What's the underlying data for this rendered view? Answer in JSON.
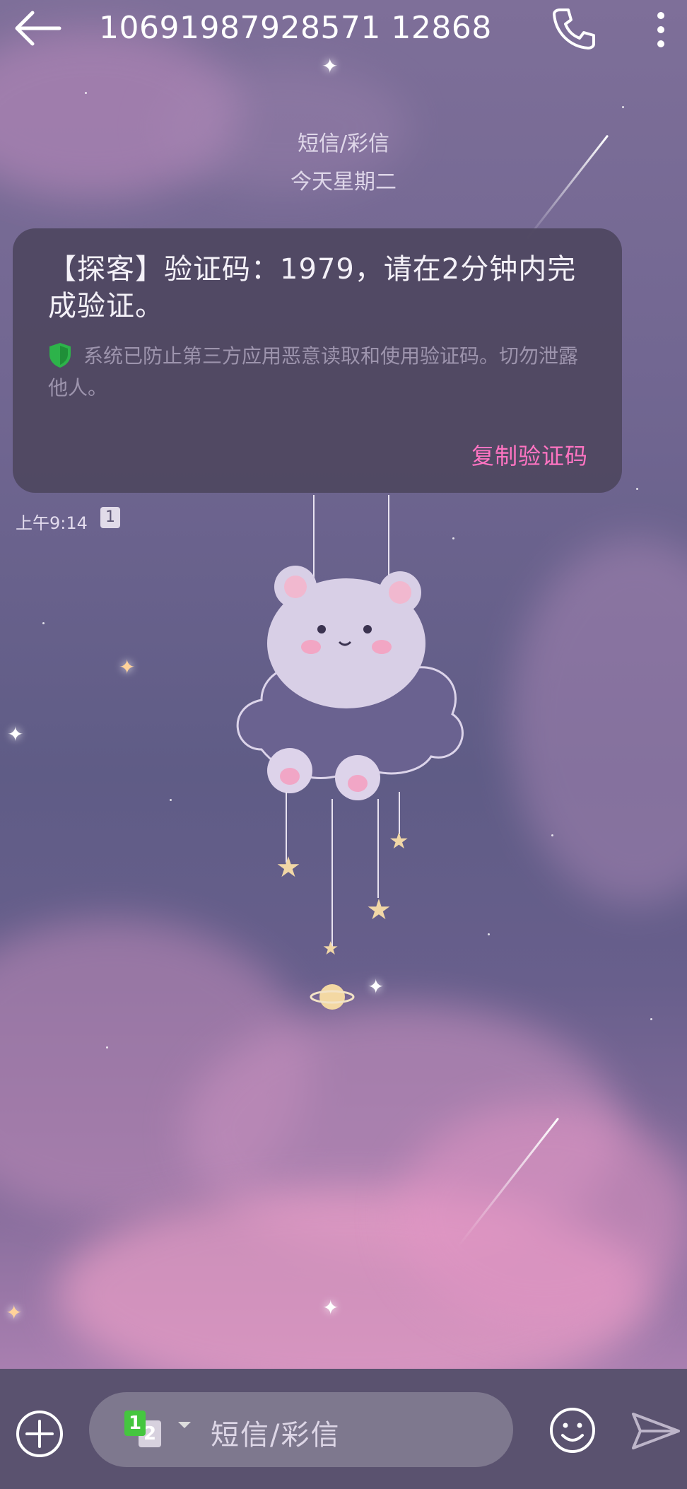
{
  "header": {
    "title": "10691987928571 12868"
  },
  "conversation": {
    "channel_label": "短信/彩信",
    "day_label": "今天星期二",
    "message": {
      "text": "【探客】验证码：1979，请在2分钟内完成验证。",
      "security_notice": "系统已防止第三方应用恶意读取和使用验证码。切勿泄露他人。",
      "copy_label": "复制验证码",
      "time": "上午9:14",
      "sim_badge": "1"
    }
  },
  "composer": {
    "sim1": "1",
    "sim2": "2",
    "placeholder": "短信/彩信"
  },
  "colors": {
    "accent": "#ff74c2",
    "bubble": "#4e4660",
    "bottom_bar": "#5a526f",
    "shield": "#2db34a"
  },
  "icons": [
    "back-arrow-icon",
    "phone-icon",
    "more-vert-icon",
    "shield-icon",
    "plus-icon",
    "chevron-down-icon",
    "emoji-icon",
    "send-icon"
  ]
}
